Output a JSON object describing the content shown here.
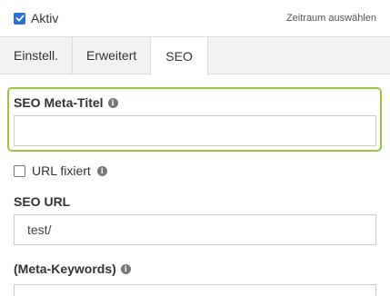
{
  "header": {
    "active_label": "Aktiv",
    "active_checked": true,
    "period_link": "Zeitraum auswählen"
  },
  "tabs": [
    {
      "label": "Einstell.",
      "active": false
    },
    {
      "label": "Erweitert",
      "active": false
    },
    {
      "label": "SEO",
      "active": true
    }
  ],
  "form": {
    "meta_title": {
      "label": "SEO Meta-Titel",
      "value": ""
    },
    "url_fixed": {
      "label": "URL fixiert",
      "checked": false
    },
    "seo_url": {
      "label": "SEO URL",
      "value": "test/"
    },
    "meta_keywords": {
      "label": "(Meta-Keywords)",
      "value": ""
    }
  },
  "colors": {
    "accent_blue": "#2d6fdb",
    "focus_green": "#9bc53d"
  },
  "icons": {
    "info": "info-icon",
    "check": "check-icon"
  }
}
